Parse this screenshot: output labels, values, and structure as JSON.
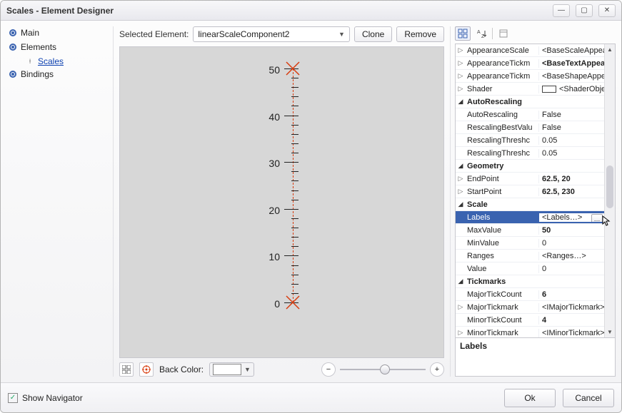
{
  "window": {
    "title": "Scales - Element Designer"
  },
  "nav": {
    "main": "Main",
    "elements": "Elements",
    "scales": "Scales",
    "bindings": "Bindings"
  },
  "toolbar": {
    "selected_label": "Selected Element:",
    "selected_value": "linearScaleComponent2",
    "clone": "Clone",
    "remove": "Remove",
    "backcolor_label": "Back Color:"
  },
  "scale": {
    "labels": [
      0,
      10,
      20,
      30,
      40,
      50
    ]
  },
  "props": {
    "rows": [
      {
        "g": "▷",
        "n": "AppearanceScale",
        "v": "<BaseScaleAppearanc"
      },
      {
        "g": "▷",
        "n": "AppearanceTickm",
        "v": "<BaseTextAppear",
        "bold": true
      },
      {
        "g": "▷",
        "n": "AppearanceTickm",
        "v": "<BaseShapeAppearan"
      },
      {
        "g": "▷",
        "n": "Shader",
        "v": "<ShaderObject",
        "shader": true
      },
      {
        "g": "◢",
        "n": "AutoRescaling",
        "v": "",
        "cat": true
      },
      {
        "g": "",
        "n": "AutoRescaling",
        "v": "False"
      },
      {
        "g": "",
        "n": "RescalingBestValu",
        "v": "False"
      },
      {
        "g": "",
        "n": "RescalingThreshc",
        "v": "0.05"
      },
      {
        "g": "",
        "n": "RescalingThreshc",
        "v": "0.05"
      },
      {
        "g": "◢",
        "n": "Geometry",
        "v": "",
        "cat": true
      },
      {
        "g": "▷",
        "n": "EndPoint",
        "v": "62.5, 20",
        "bold": true
      },
      {
        "g": "▷",
        "n": "StartPoint",
        "v": "62.5, 230",
        "bold": true
      },
      {
        "g": "◢",
        "n": "Scale",
        "v": "",
        "cat": true
      },
      {
        "g": "",
        "n": "Labels",
        "v": "<Labels…>",
        "selected": true,
        "btn": true
      },
      {
        "g": "",
        "n": "MaxValue",
        "v": "50",
        "bold": true
      },
      {
        "g": "",
        "n": "MinValue",
        "v": "0"
      },
      {
        "g": "",
        "n": "Ranges",
        "v": "<Ranges…>"
      },
      {
        "g": "",
        "n": "Value",
        "v": "0"
      },
      {
        "g": "◢",
        "n": "Tickmarks",
        "v": "",
        "cat": true
      },
      {
        "g": "",
        "n": "MajorTickCount",
        "v": "6",
        "bold": true
      },
      {
        "g": "▷",
        "n": "MajorTickmark",
        "v": "<IMajorTickmark>"
      },
      {
        "g": "",
        "n": "MinorTickCount",
        "v": "4",
        "bold": true
      },
      {
        "g": "▷",
        "n": "MinorTickmark",
        "v": "<IMinorTickmark>"
      }
    ],
    "desc_title": "Labels"
  },
  "footer": {
    "show_nav": "Show Navigator",
    "ok": "Ok",
    "cancel": "Cancel"
  }
}
